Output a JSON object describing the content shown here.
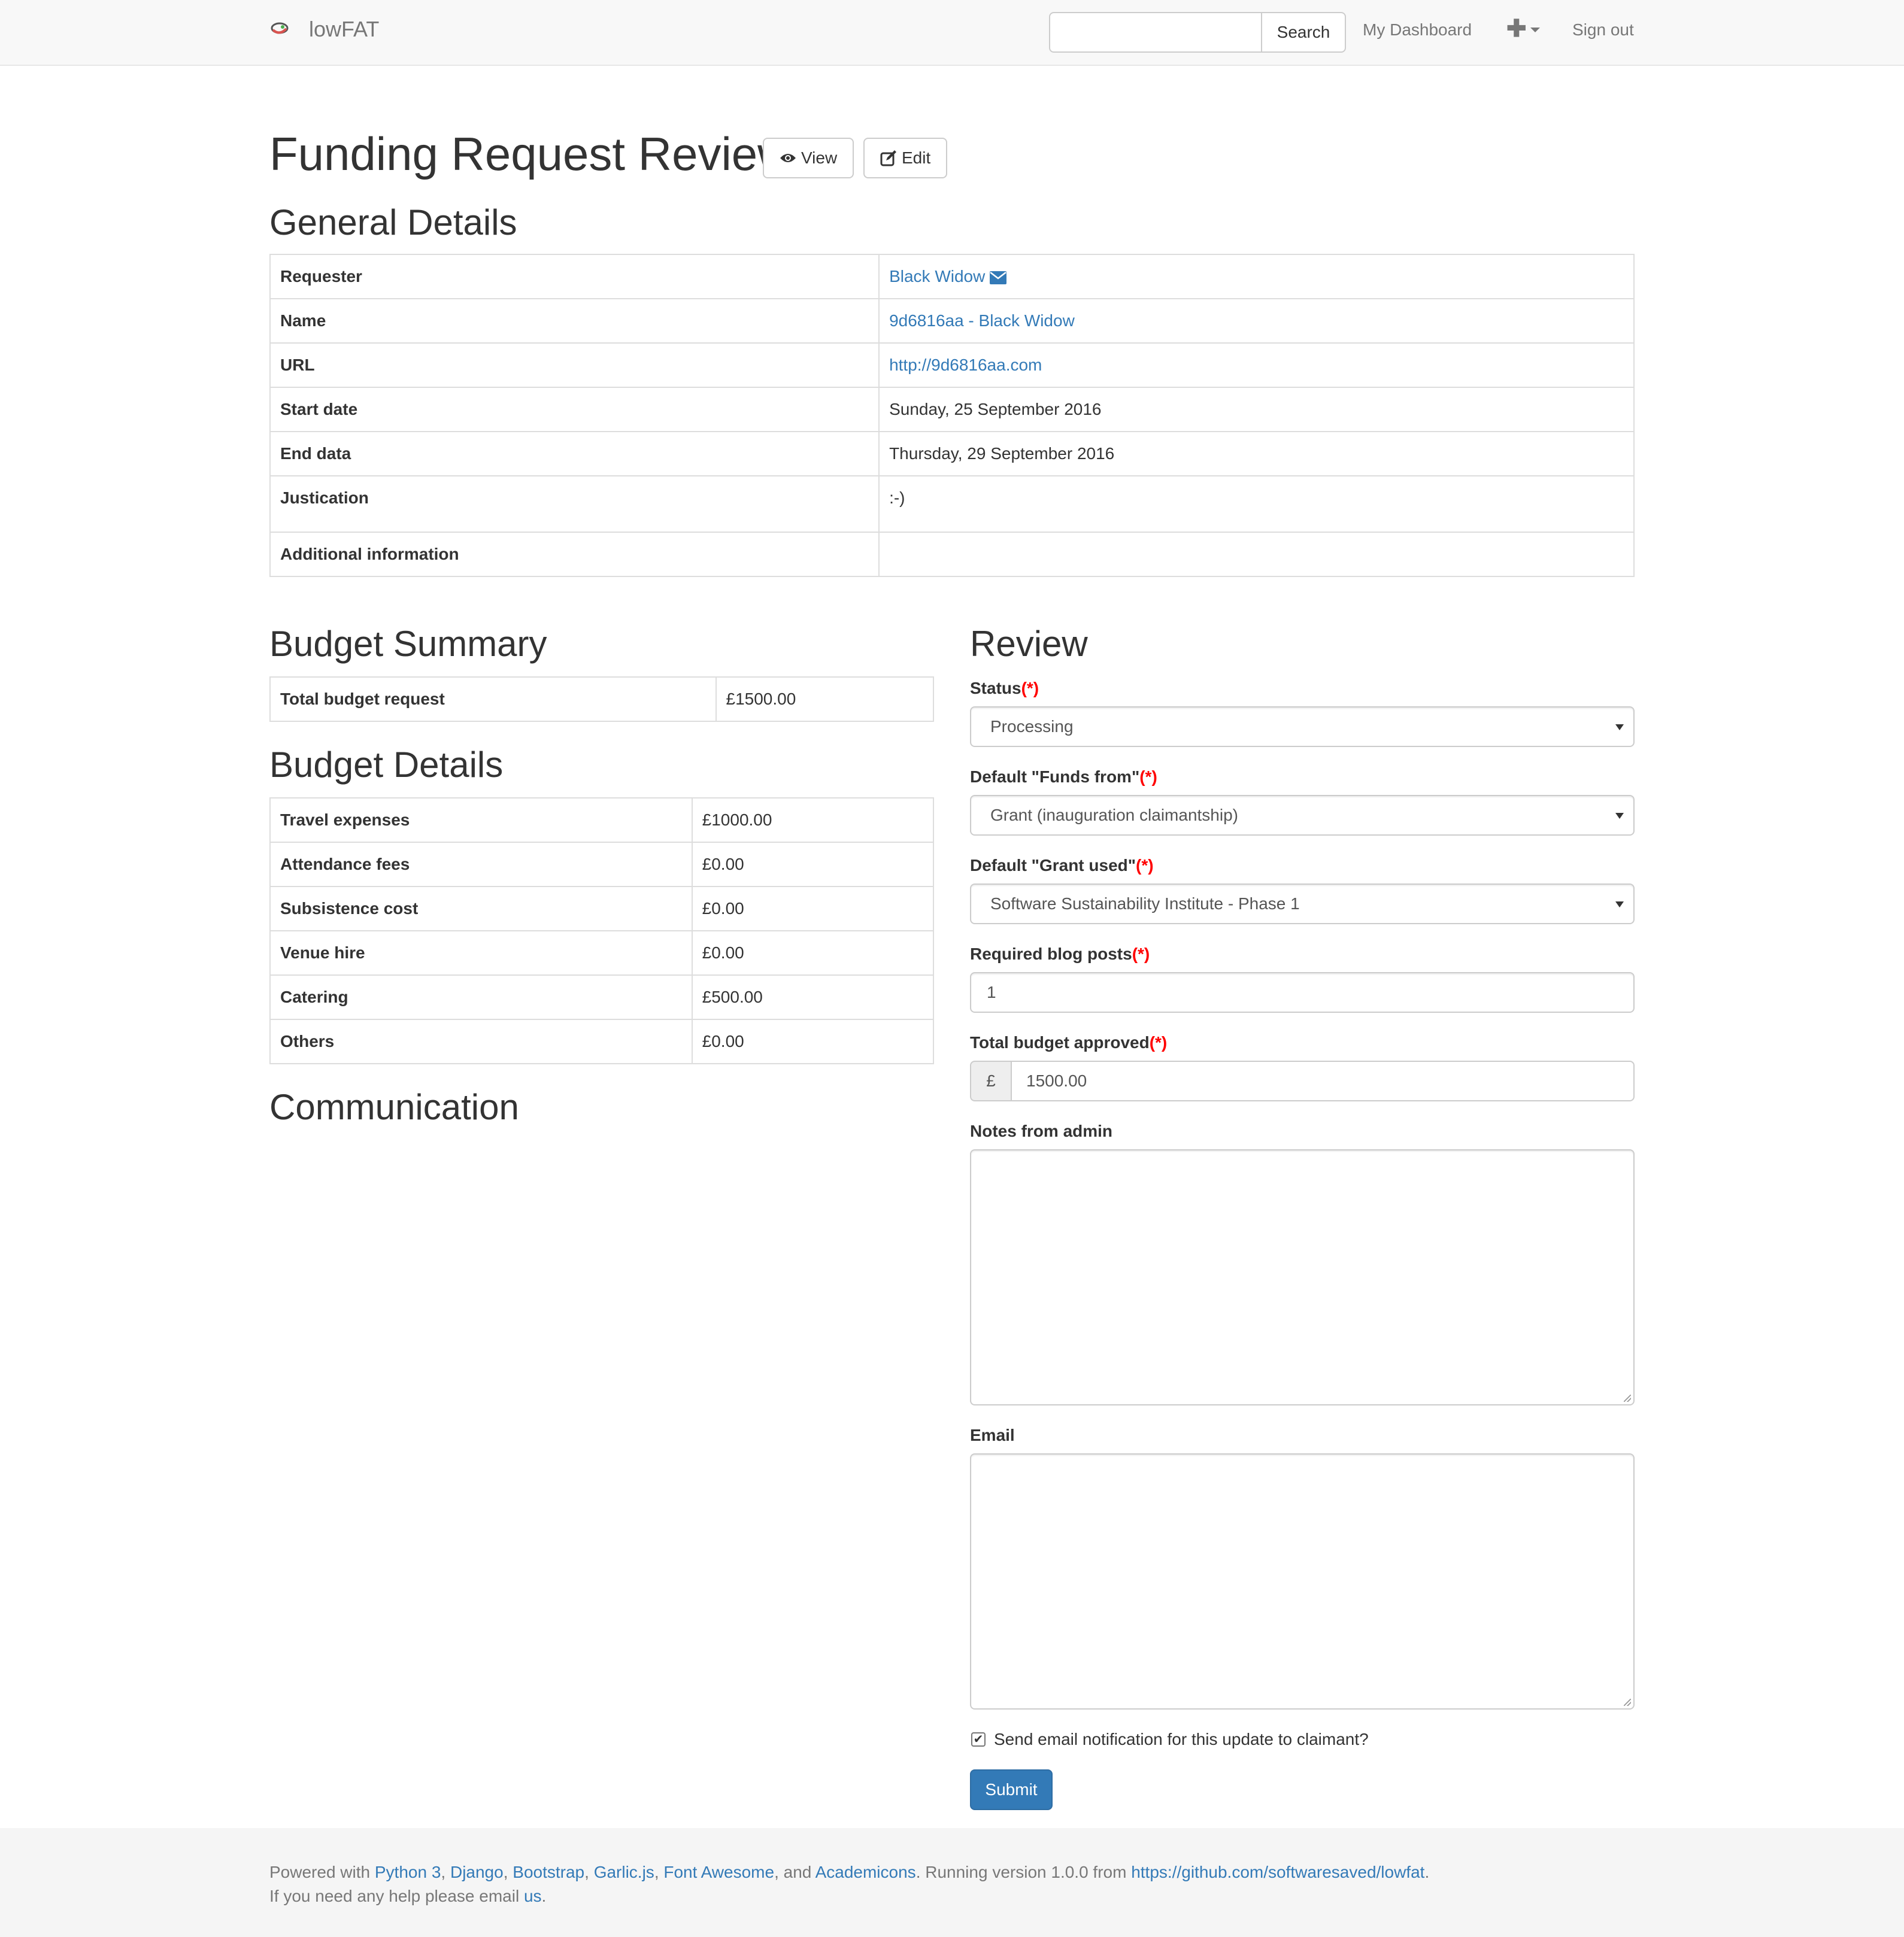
{
  "navbar": {
    "brand": "lowFAT",
    "search_placeholder": "",
    "search_button": "Search",
    "dashboard": "My Dashboard",
    "signout": "Sign out"
  },
  "header": {
    "title": "Funding Request Review",
    "view_button": "View",
    "edit_button": "Edit"
  },
  "general": {
    "heading": "General Details",
    "rows": [
      {
        "label": "Requester",
        "value": "Black Widow"
      },
      {
        "label": "Name",
        "value": "9d6816aa - Black Widow"
      },
      {
        "label": "URL",
        "value": "http://9d6816aa.com"
      },
      {
        "label": "Start date",
        "value": "Sunday, 25 September 2016"
      },
      {
        "label": "End data",
        "value": "Thursday, 29 September 2016"
      },
      {
        "label": "Justication",
        "value": ":-)"
      },
      {
        "label": "Additional information",
        "value": ""
      }
    ]
  },
  "budget_summary": {
    "heading": "Budget Summary",
    "label": "Total budget request",
    "value": "£1500.00"
  },
  "budget_details": {
    "heading": "Budget Details",
    "rows": [
      {
        "label": "Travel expenses",
        "value": "£1000.00"
      },
      {
        "label": "Attendance fees",
        "value": "£0.00"
      },
      {
        "label": "Subsistence cost",
        "value": "£0.00"
      },
      {
        "label": "Venue hire",
        "value": "£0.00"
      },
      {
        "label": "Catering",
        "value": "£500.00"
      },
      {
        "label": "Others",
        "value": "£0.00"
      }
    ]
  },
  "communication": {
    "heading": "Communication"
  },
  "review": {
    "heading": "Review",
    "required_mark": "(*)",
    "status_label": "Status",
    "status_value": "Processing",
    "funds_label": "Default \"Funds from\"",
    "funds_value": "Grant (inauguration claimantship)",
    "grant_label": "Default \"Grant used\"",
    "grant_value": "Software Sustainability Institute - Phase 1",
    "blog_label": "Required blog posts",
    "blog_value": "1",
    "budget_label": "Total budget approved",
    "budget_currency": "£",
    "budget_value": "1500.00",
    "notes_label": "Notes from admin",
    "notes_value": "",
    "email_label": "Email",
    "email_value": "",
    "notify_label": "Send email notification for this update to claimant?",
    "notify_checked": true,
    "submit": "Submit"
  },
  "footer": {
    "powered_prefix": "Powered with ",
    "python": "Python 3",
    "sep1": ", ",
    "django": "Django",
    "sep2": ", ",
    "bootstrap": "Bootstrap",
    "sep3": ", ",
    "garlic": "Garlic.js",
    "sep4": ", ",
    "fontawesome": "Font Awesome",
    "sep5": ", and ",
    "academicons": "Academicons",
    "version_text": ". Running version 1.0.0 from ",
    "repo": "https://github.com/softwaresaved/lowfat",
    "end": ".",
    "help_prefix": "If you need any help please email ",
    "help_link": "us",
    "help_end": "."
  },
  "colors": {
    "link": "#337ab7",
    "primary": "#337ab7",
    "required": "#ff0000",
    "navbar_bg": "#f8f8f8",
    "footer_bg": "#f5f5f5"
  }
}
